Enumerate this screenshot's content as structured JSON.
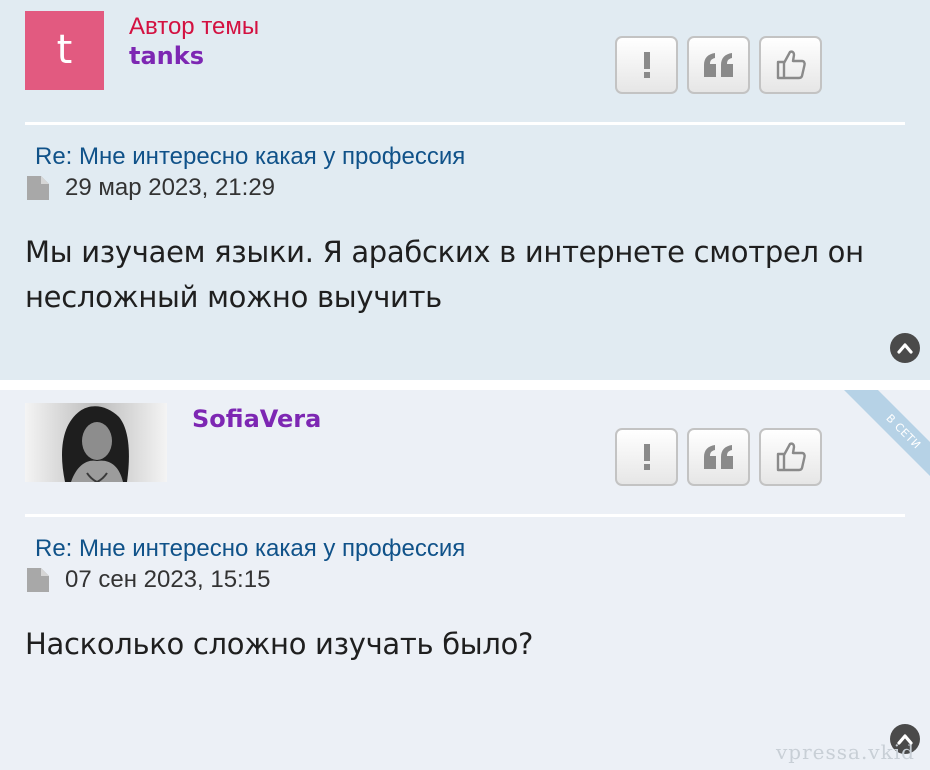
{
  "icons": {
    "report": "exclamation-icon",
    "quote": "quote-icon",
    "like": "thumbs-up-icon",
    "post_file": "file-icon",
    "scroll_top": "chevron-up-icon"
  },
  "colors": {
    "post_bg_1": "#e1ebf2",
    "post_bg_2": "#ecf0f6",
    "author_role": "#d31141",
    "author_name": "#7d27b3",
    "subject_link": "#105289",
    "avatar_letter_bg": "#e25a80"
  },
  "posts": [
    {
      "avatar_letter": "t",
      "author_role": "Автор темы",
      "author_name": "tanks",
      "subject": "Re: Мне интересно какая у профессия",
      "date": "29 мар 2023, 21:29",
      "content": "Мы изучаем языки. Я арабских в интернете смотрел он несложный можно выучить"
    },
    {
      "author_name": "SofiaVera",
      "online_label": "В СЕТИ",
      "subject": "Re: Мне интересно какая у профессия",
      "date": "07 сен 2023, 15:15",
      "content": "Насколько сложно изучать было?"
    }
  ],
  "watermark": "vpressa.vkid"
}
